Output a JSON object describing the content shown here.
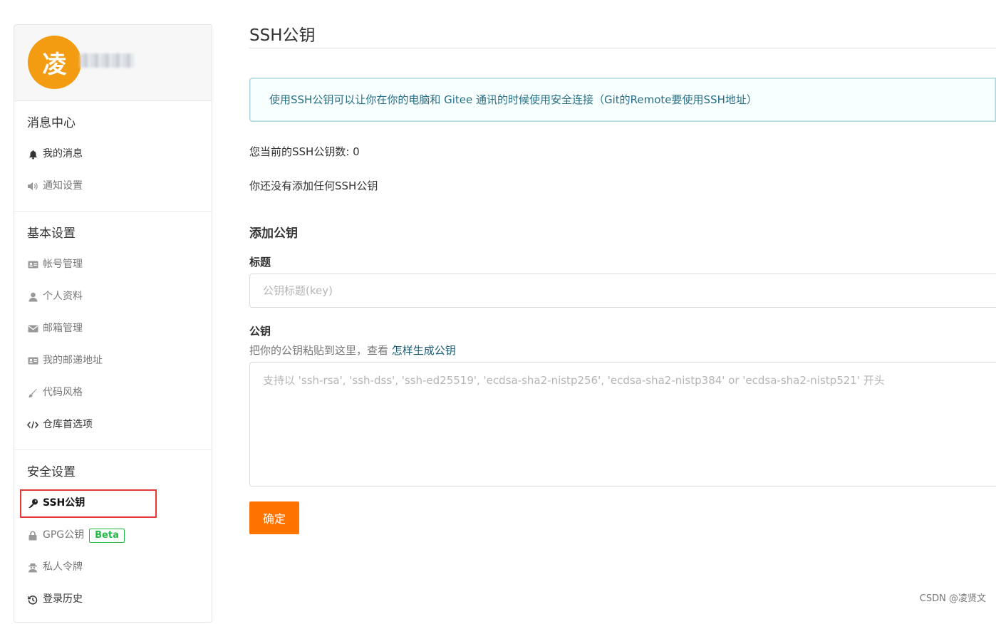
{
  "profile": {
    "avatar_char": "凌"
  },
  "sidebar": {
    "sections": [
      {
        "title": "消息中心",
        "items": [
          {
            "label": "我的消息",
            "icon": "bell-icon"
          },
          {
            "label": "通知设置",
            "icon": "volume-icon"
          }
        ]
      },
      {
        "title": "基本设置",
        "items": [
          {
            "label": "帐号管理",
            "icon": "id-card-icon"
          },
          {
            "label": "个人资料",
            "icon": "user-icon"
          },
          {
            "label": "邮箱管理",
            "icon": "envelope-icon"
          },
          {
            "label": "我的邮递地址",
            "icon": "address-card-icon"
          },
          {
            "label": "代码风格",
            "icon": "paint-brush-icon"
          },
          {
            "label": "仓库首选项",
            "icon": "code-icon"
          }
        ]
      },
      {
        "title": "安全设置",
        "items": [
          {
            "label": "SSH公钥",
            "icon": "key-icon",
            "active": true
          },
          {
            "label": "GPG公钥",
            "icon": "lock-icon",
            "badge": "Beta"
          },
          {
            "label": "私人令牌",
            "icon": "user-secret-icon"
          },
          {
            "label": "登录历史",
            "icon": "history-icon"
          }
        ]
      }
    ]
  },
  "main": {
    "title": "SSH公钥",
    "info": "使用SSH公钥可以让你在你的电脑和 Gitee 通讯的时候使用安全连接（Git的Remote要使用SSH地址）",
    "count_text": "您当前的SSH公钥数: 0",
    "empty_text": "你还没有添加任何SSH公钥",
    "add_title": "添加公钥",
    "title_label": "标题",
    "title_placeholder": "公钥标题(key)",
    "key_label": "公钥",
    "key_hint": "把你的公钥粘贴到这里，查看",
    "key_hint_link": "怎样生成公钥",
    "key_placeholder": "支持以 'ssh-rsa', 'ssh-dss', 'ssh-ed25519', 'ecdsa-sha2-nistp256', 'ecdsa-sha2-nistp384' or 'ecdsa-sha2-nistp521' 开头",
    "submit_label": "确定"
  },
  "watermark": "CSDN @凌贤文",
  "colors": {
    "accent": "#fe7300",
    "avatar": "#f39c12",
    "info_text": "#276f86",
    "highlight_border": "#e53935",
    "beta": "#21ba45"
  }
}
